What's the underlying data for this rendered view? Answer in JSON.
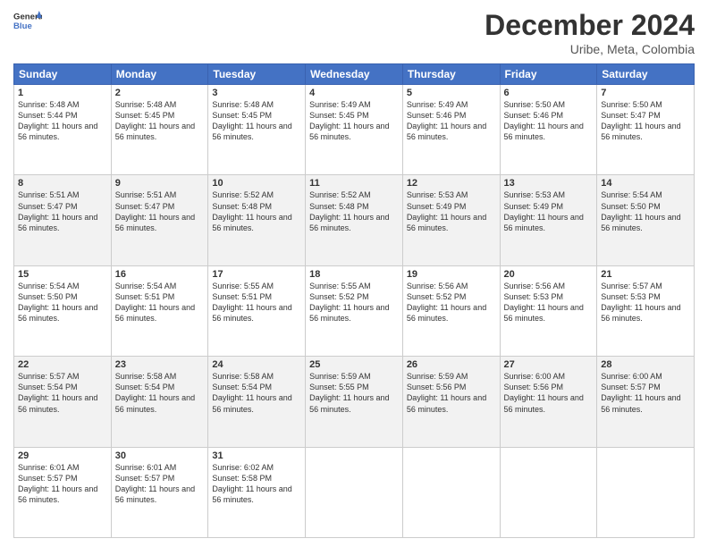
{
  "header": {
    "logo_line1": "General",
    "logo_line2": "Blue",
    "title": "December 2024",
    "subtitle": "Uribe, Meta, Colombia"
  },
  "weekdays": [
    "Sunday",
    "Monday",
    "Tuesday",
    "Wednesday",
    "Thursday",
    "Friday",
    "Saturday"
  ],
  "weeks": [
    [
      {
        "day": "1",
        "sunrise": "5:48 AM",
        "sunset": "5:44 PM",
        "daylight": "11 hours and 56 minutes."
      },
      {
        "day": "2",
        "sunrise": "5:48 AM",
        "sunset": "5:45 PM",
        "daylight": "11 hours and 56 minutes."
      },
      {
        "day": "3",
        "sunrise": "5:48 AM",
        "sunset": "5:45 PM",
        "daylight": "11 hours and 56 minutes."
      },
      {
        "day": "4",
        "sunrise": "5:49 AM",
        "sunset": "5:45 PM",
        "daylight": "11 hours and 56 minutes."
      },
      {
        "day": "5",
        "sunrise": "5:49 AM",
        "sunset": "5:46 PM",
        "daylight": "11 hours and 56 minutes."
      },
      {
        "day": "6",
        "sunrise": "5:50 AM",
        "sunset": "5:46 PM",
        "daylight": "11 hours and 56 minutes."
      },
      {
        "day": "7",
        "sunrise": "5:50 AM",
        "sunset": "5:47 PM",
        "daylight": "11 hours and 56 minutes."
      }
    ],
    [
      {
        "day": "8",
        "sunrise": "5:51 AM",
        "sunset": "5:47 PM",
        "daylight": "11 hours and 56 minutes."
      },
      {
        "day": "9",
        "sunrise": "5:51 AM",
        "sunset": "5:47 PM",
        "daylight": "11 hours and 56 minutes."
      },
      {
        "day": "10",
        "sunrise": "5:52 AM",
        "sunset": "5:48 PM",
        "daylight": "11 hours and 56 minutes."
      },
      {
        "day": "11",
        "sunrise": "5:52 AM",
        "sunset": "5:48 PM",
        "daylight": "11 hours and 56 minutes."
      },
      {
        "day": "12",
        "sunrise": "5:53 AM",
        "sunset": "5:49 PM",
        "daylight": "11 hours and 56 minutes."
      },
      {
        "day": "13",
        "sunrise": "5:53 AM",
        "sunset": "5:49 PM",
        "daylight": "11 hours and 56 minutes."
      },
      {
        "day": "14",
        "sunrise": "5:54 AM",
        "sunset": "5:50 PM",
        "daylight": "11 hours and 56 minutes."
      }
    ],
    [
      {
        "day": "15",
        "sunrise": "5:54 AM",
        "sunset": "5:50 PM",
        "daylight": "11 hours and 56 minutes."
      },
      {
        "day": "16",
        "sunrise": "5:54 AM",
        "sunset": "5:51 PM",
        "daylight": "11 hours and 56 minutes."
      },
      {
        "day": "17",
        "sunrise": "5:55 AM",
        "sunset": "5:51 PM",
        "daylight": "11 hours and 56 minutes."
      },
      {
        "day": "18",
        "sunrise": "5:55 AM",
        "sunset": "5:52 PM",
        "daylight": "11 hours and 56 minutes."
      },
      {
        "day": "19",
        "sunrise": "5:56 AM",
        "sunset": "5:52 PM",
        "daylight": "11 hours and 56 minutes."
      },
      {
        "day": "20",
        "sunrise": "5:56 AM",
        "sunset": "5:53 PM",
        "daylight": "11 hours and 56 minutes."
      },
      {
        "day": "21",
        "sunrise": "5:57 AM",
        "sunset": "5:53 PM",
        "daylight": "11 hours and 56 minutes."
      }
    ],
    [
      {
        "day": "22",
        "sunrise": "5:57 AM",
        "sunset": "5:54 PM",
        "daylight": "11 hours and 56 minutes."
      },
      {
        "day": "23",
        "sunrise": "5:58 AM",
        "sunset": "5:54 PM",
        "daylight": "11 hours and 56 minutes."
      },
      {
        "day": "24",
        "sunrise": "5:58 AM",
        "sunset": "5:54 PM",
        "daylight": "11 hours and 56 minutes."
      },
      {
        "day": "25",
        "sunrise": "5:59 AM",
        "sunset": "5:55 PM",
        "daylight": "11 hours and 56 minutes."
      },
      {
        "day": "26",
        "sunrise": "5:59 AM",
        "sunset": "5:56 PM",
        "daylight": "11 hours and 56 minutes."
      },
      {
        "day": "27",
        "sunrise": "6:00 AM",
        "sunset": "5:56 PM",
        "daylight": "11 hours and 56 minutes."
      },
      {
        "day": "28",
        "sunrise": "6:00 AM",
        "sunset": "5:57 PM",
        "daylight": "11 hours and 56 minutes."
      }
    ],
    [
      {
        "day": "29",
        "sunrise": "6:01 AM",
        "sunset": "5:57 PM",
        "daylight": "11 hours and 56 minutes."
      },
      {
        "day": "30",
        "sunrise": "6:01 AM",
        "sunset": "5:57 PM",
        "daylight": "11 hours and 56 minutes."
      },
      {
        "day": "31",
        "sunrise": "6:02 AM",
        "sunset": "5:58 PM",
        "daylight": "11 hours and 56 minutes."
      },
      null,
      null,
      null,
      null
    ]
  ],
  "labels": {
    "sunrise_prefix": "Sunrise: ",
    "sunset_prefix": "Sunset: ",
    "daylight_prefix": "Daylight: "
  }
}
